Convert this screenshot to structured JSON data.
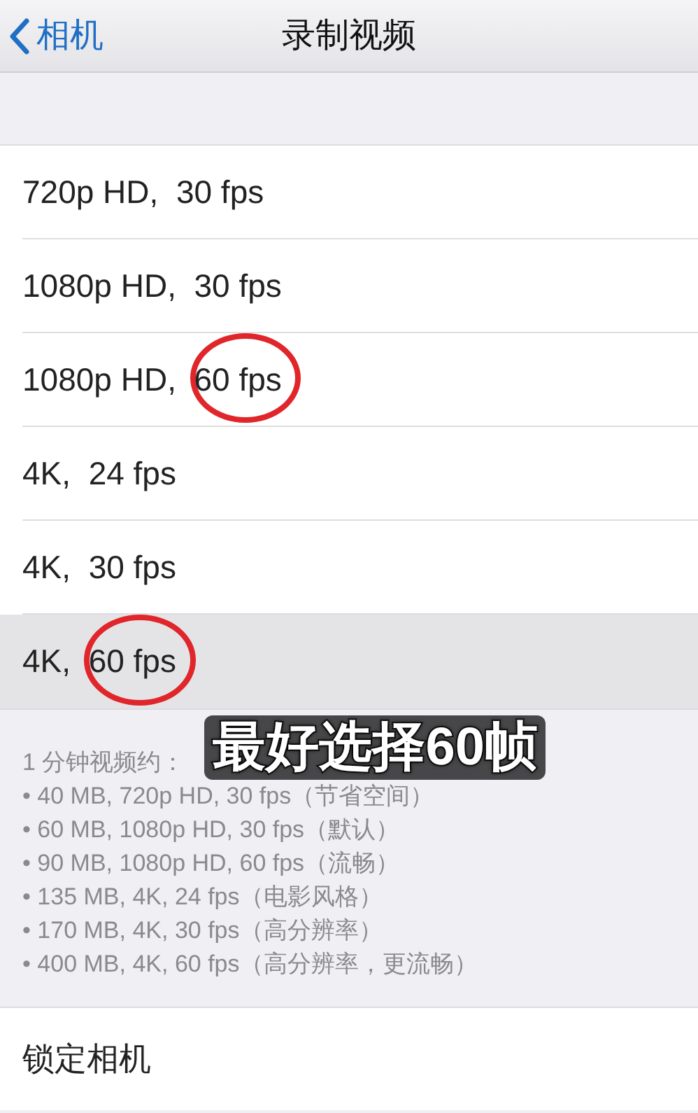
{
  "nav": {
    "back": "相机",
    "title": "录制视频"
  },
  "options": [
    {
      "format": "720p HD,",
      "rate": "30 fps",
      "selected": false,
      "circled": false
    },
    {
      "format": "1080p HD,",
      "rate": "30 fps",
      "selected": false,
      "circled": false
    },
    {
      "format": "1080p HD,",
      "rate": "60 fps",
      "selected": false,
      "circled": true
    },
    {
      "format": "4K,",
      "rate": "24 fps",
      "selected": false,
      "circled": false
    },
    {
      "format": "4K,",
      "rate": "30 fps",
      "selected": false,
      "circled": false
    },
    {
      "format": "4K,",
      "rate": "60 fps",
      "selected": true,
      "circled": true
    }
  ],
  "notes": {
    "heading": "1 分钟视频约：",
    "items": [
      "• 40 MB, 720p HD, 30 fps（节省空间）",
      "• 60 MB, 1080p HD, 30 fps（默认）",
      "• 90 MB, 1080p HD, 60 fps（流畅）",
      "• 135 MB, 4K, 24 fps（电影风格）",
      "• 170 MB, 4K, 30 fps（高分辨率）",
      "• 400 MB, 4K, 60 fps（高分辨率，更流畅）"
    ]
  },
  "caption": "最好选择60帧",
  "lock_row": {
    "label": "锁定相机"
  }
}
